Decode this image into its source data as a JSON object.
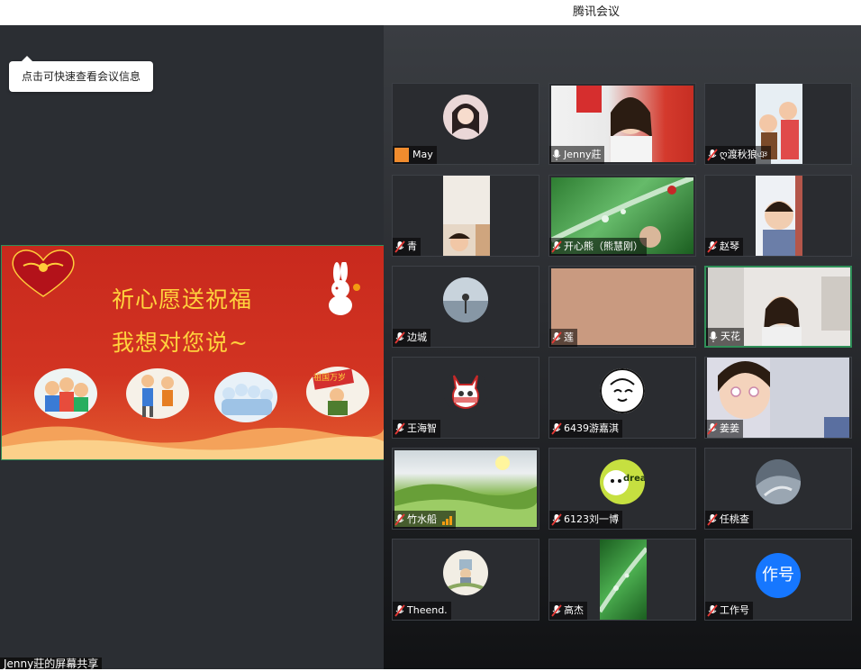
{
  "window": {
    "title": "腾讯会议"
  },
  "tooltip": {
    "text": "点击可快速查看会议信息"
  },
  "screen_share": {
    "line1": "祈心愿送祝福",
    "line2": "我想对您说~",
    "stamp_text": "祖国万岁",
    "label": "Jenny莊的屏幕共享"
  },
  "participants": [
    {
      "name": "May",
      "mic": "none"
    },
    {
      "name": "Jenny莊",
      "mic": "on"
    },
    {
      "name": "ღ渡秋狼ঞ",
      "mic": "muted"
    },
    {
      "name": "青",
      "mic": "muted"
    },
    {
      "name": "开心熊（熊慧刚）",
      "mic": "muted"
    },
    {
      "name": "赵琴",
      "mic": "muted"
    },
    {
      "name": "边城",
      "mic": "muted"
    },
    {
      "name": "莲",
      "mic": "muted"
    },
    {
      "name": "天花",
      "mic": "on",
      "speaking": true
    },
    {
      "name": "王海智",
      "mic": "muted"
    },
    {
      "name": "6439游嘉淇",
      "mic": "muted"
    },
    {
      "name": "姜姜",
      "mic": "muted"
    },
    {
      "name": "竹水船",
      "mic": "muted",
      "signal": "weak"
    },
    {
      "name": "6123刘一博",
      "mic": "muted"
    },
    {
      "name": "任桃查",
      "mic": "muted"
    },
    {
      "name": "Theend.",
      "mic": "muted"
    },
    {
      "name": "高杰",
      "mic": "muted"
    },
    {
      "name": "工作号",
      "mic": "muted",
      "avatar_text": "作号"
    }
  ],
  "dream_text": "dream",
  "colors": {
    "accent_blue": "#1677ff",
    "active_border": "#2f8f58",
    "muted_red": "#e53935"
  }
}
